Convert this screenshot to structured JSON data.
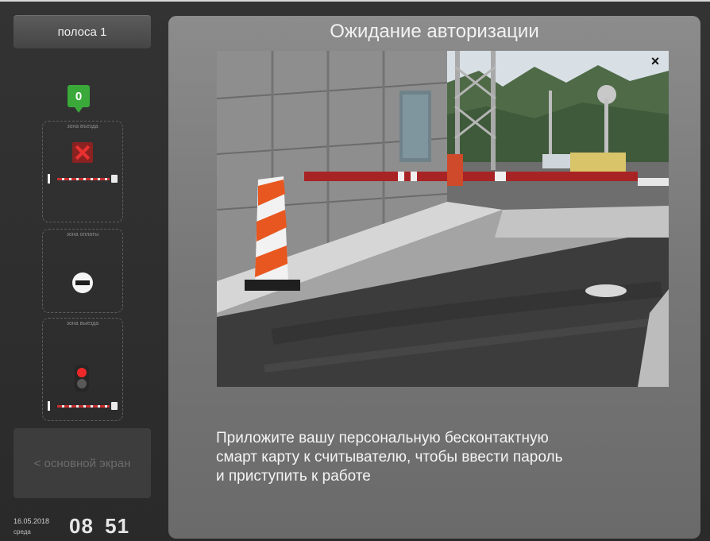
{
  "sidebar": {
    "lane_label": "полоса 1",
    "counter": "0",
    "zones": [
      {
        "label": "зона въезда",
        "state": "closed"
      },
      {
        "label": "зона оплаты",
        "state": "no-entry"
      },
      {
        "label": "зона выезда",
        "state": "red-light"
      }
    ],
    "main_screen_label": "< основной экран",
    "clock": {
      "date": "16.05.2018",
      "weekday": "среда",
      "time": "08 51"
    }
  },
  "main": {
    "title": "Ожидание авторизации",
    "close_icon": "×",
    "instruction_lines": [
      "Приложите вашу персональную бесконтактную",
      "смарт карту к считывателю, чтобы ввести пароль",
      "и приступить к работе"
    ]
  },
  "colors": {
    "status_green": "#3aa93a",
    "alert_red": "#e83030",
    "panel_gray": "#808080"
  }
}
